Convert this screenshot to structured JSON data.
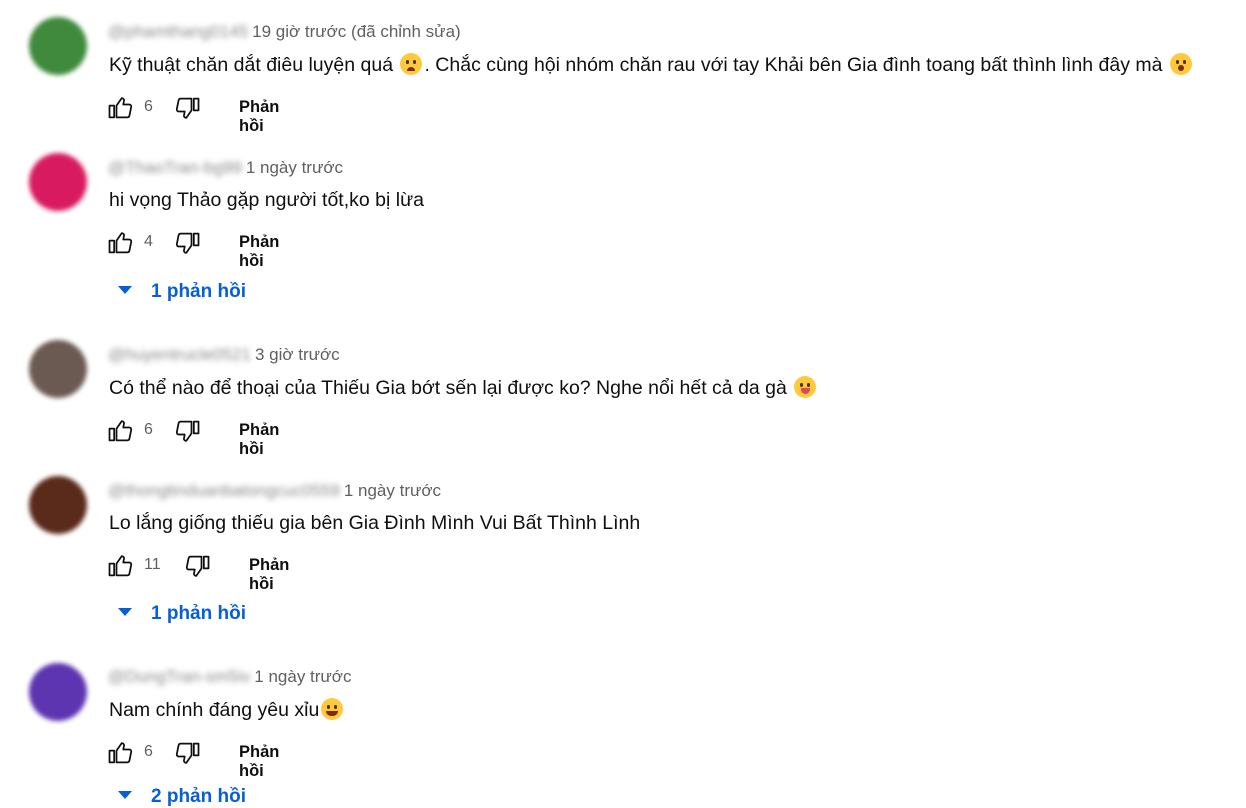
{
  "colors": {
    "link": "#065fd4",
    "meta": "#606060",
    "text": "#0f0f0f"
  },
  "comments": [
    {
      "handle": "@phamthang0145",
      "time": "19 giờ trước (đã chỉnh sửa)",
      "text_a": "Kỹ thuật chăn dắt điêu luyện quá ",
      "emoji_a": "crying-face",
      "text_b": ". Chắc cùng hội nhóm chăn rau với tay Khải bên Gia đình toang bất thình lình đây mà ",
      "emoji_b": "astonished-face",
      "likes": "6",
      "reply_label": "Phản hồi",
      "avatar_color": "#3f8a3c"
    },
    {
      "handle": "@ThaoTran-bg99",
      "time": "1 ngày trước",
      "text_a": "hi vọng Thảo gặp người tốt,ko bị lừa",
      "likes": "4",
      "reply_label": "Phản hồi",
      "replies_label": "1 phản hồi",
      "avatar_color": "#d81b60"
    },
    {
      "handle": "@huyentrucle0521",
      "time": "3 giờ trước",
      "text_a": "Có thể nào để thoại của Thiếu Gia bớt sến lại được ko? Nghe nổi hết cả da gà ",
      "emoji_a": "tongue-face",
      "likes": "6",
      "reply_label": "Phản hồi",
      "avatar_color": "#6b5a52"
    },
    {
      "handle": "@thongtinduanbatongcuc0559",
      "time": "1 ngày trước",
      "text_a": "Lo lắng giống thiếu gia bên Gia Đình Mình Vui Bất Thình Lình",
      "likes": "11",
      "reply_label": "Phản hồi",
      "replies_label": "1 phản hồi",
      "avatar_color": "#5a2a1a"
    },
    {
      "handle": "@DungTran-sm5iv",
      "time": "1 ngày trước",
      "text_a": "Nam chính đáng yêu xỉu",
      "emoji_a": "laughing-face",
      "likes": "6",
      "reply_label": "Phản hồi",
      "replies_label": "2 phản hồi",
      "avatar_color": "#5e35b1"
    }
  ]
}
